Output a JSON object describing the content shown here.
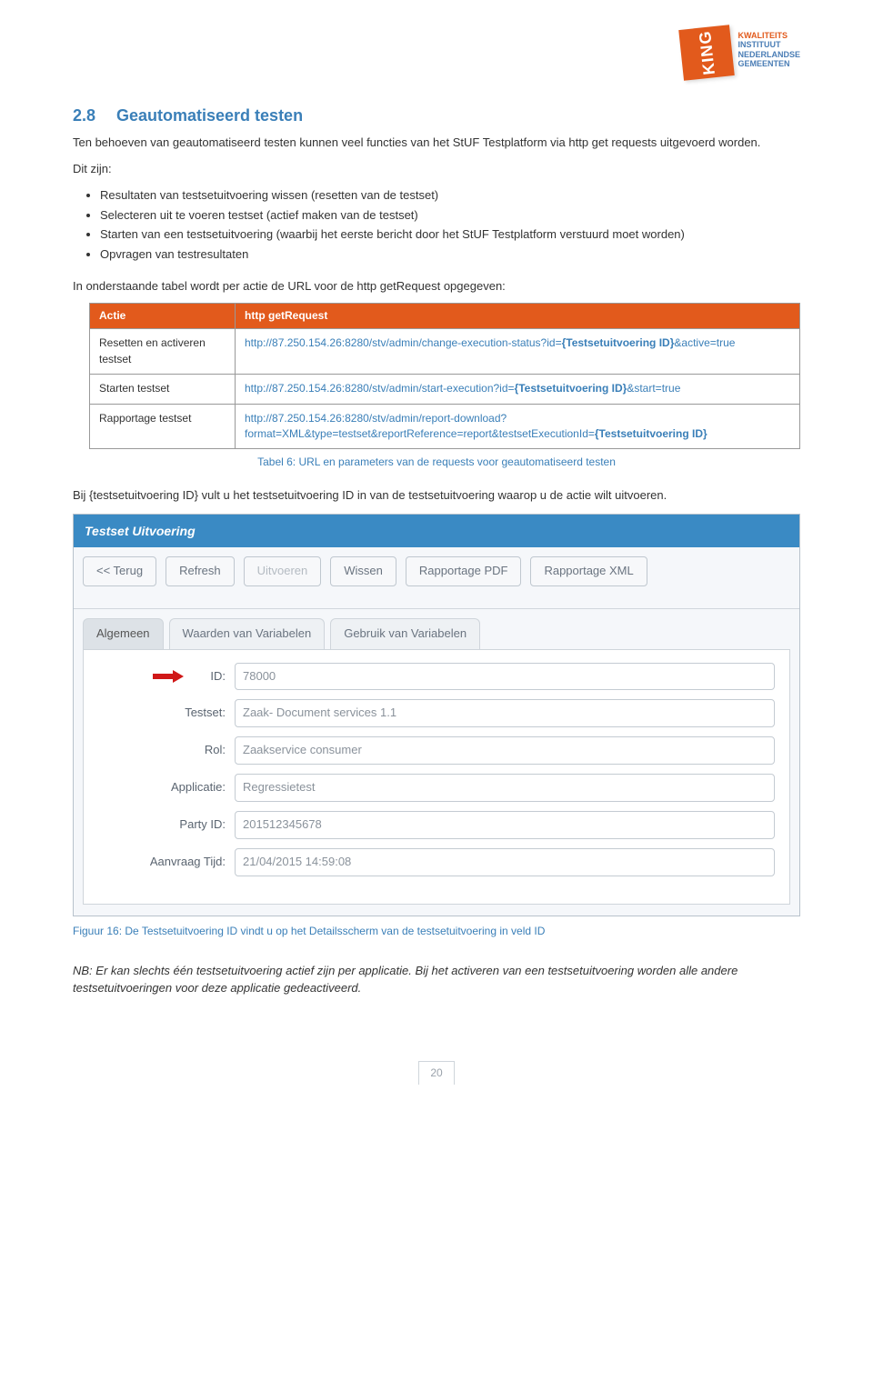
{
  "logo": {
    "box_text": "KING",
    "line1": "KWALITEITS",
    "line2": "INSTITUUT",
    "line3": "NEDERLANDSE",
    "line4": "GEMEENTEN"
  },
  "section": {
    "num": "2.8",
    "title": "Geautomatiseerd testen"
  },
  "para_intro": "Ten behoeven van geautomatiseerd testen kunnen veel functies van het StUF Testplatform via http get requests uitgevoerd worden.",
  "para_ditzijn": "Dit zijn:",
  "bullets": {
    "b1": "Resultaten van testsetuitvoering wissen (resetten van de testset)",
    "b2": "Selecteren uit te voeren testset (actief maken van de testset)",
    "b3": "Starten van een testsetuitvoering (waarbij het eerste bericht door het StUF Testplatform verstuurd moet worden)",
    "b4": "Opvragen van testresultaten"
  },
  "para_tablelead": "In onderstaande tabel wordt per actie de URL voor de http getRequest opgegeven:",
  "table": {
    "h1": "Actie",
    "h2": "http getRequest",
    "r1c1": "Resetten en activeren testset",
    "r1c2_a": "http://87.250.154.26:8280/stv/admin/change-execution-status?id=",
    "r1c2_b": "{Testsetuitvoering ID}",
    "r1c2_c": "&active=true",
    "r2c1": "Starten testset",
    "r2c2_a": "http://87.250.154.26:8280/stv/admin/start-execution?id=",
    "r2c2_b": "{Testsetuitvoering ID}",
    "r2c2_c": "&start=true",
    "r3c1": "Rapportage testset",
    "r3c2_a": "http://87.250.154.26:8280/stv/admin/report-download?format=XML&type=testset&reportReference=report&testsetExecutionId=",
    "r3c2_b": "{Testsetuitvoering ID}"
  },
  "table_caption": "Tabel 6: URL en parameters van de requests voor geautomatiseerd testen",
  "para_after": "Bij {testsetuitvoering ID} vult u het testsetuitvoering ID in van de testsetuitvoering waarop u de actie wilt uitvoeren.",
  "shot": {
    "header": "Testset Uitvoering",
    "btn_back": "<< Terug",
    "btn_refresh": "Refresh",
    "btn_uitvoeren": "Uitvoeren",
    "btn_wissen": "Wissen",
    "btn_rap_pdf": "Rapportage PDF",
    "btn_rap_xml": "Rapportage XML",
    "tab1": "Algemeen",
    "tab2": "Waarden van Variabelen",
    "tab3": "Gebruik van Variabelen",
    "fld_id_lbl": "ID:",
    "fld_id_val": "78000",
    "fld_testset_lbl": "Testset:",
    "fld_testset_val": "Zaak- Document services 1.1",
    "fld_rol_lbl": "Rol:",
    "fld_rol_val": "Zaakservice consumer",
    "fld_app_lbl": "Applicatie:",
    "fld_app_val": "Regressietest",
    "fld_party_lbl": "Party ID:",
    "fld_party_val": "201512345678",
    "fld_tijd_lbl": "Aanvraag Tijd:",
    "fld_tijd_val": "21/04/2015 14:59:08"
  },
  "fig_caption": "Figuur 16: De Testsetuitvoering ID vindt u op het Detailsscherm van de testsetuitvoering in veld ID",
  "para_nb": "NB: Er kan slechts één testsetuitvoering actief zijn per applicatie. Bij het activeren van een testsetuitvoering worden alle andere testsetuitvoeringen voor deze applicatie gedeactiveerd.",
  "page_number": "20"
}
